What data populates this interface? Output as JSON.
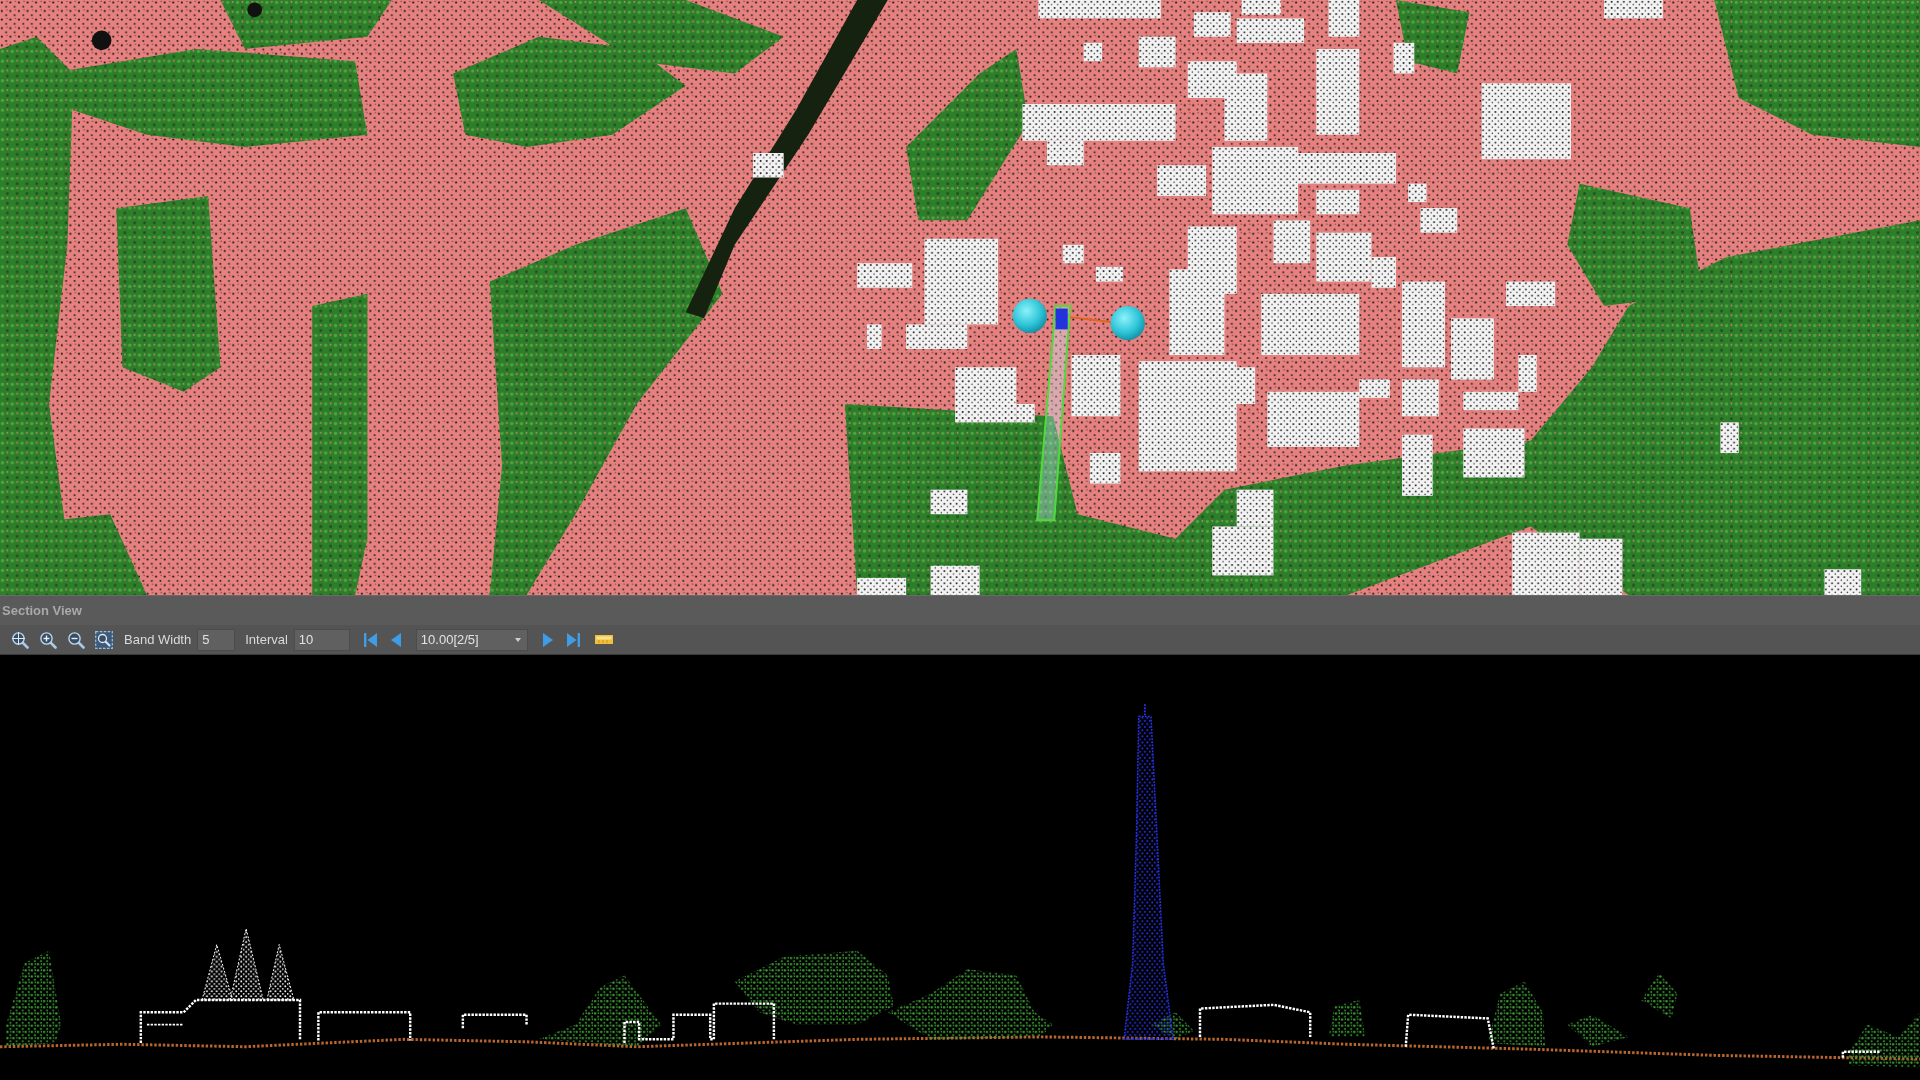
{
  "section_view": {
    "title": "Section View",
    "band_width": {
      "label": "Band Width",
      "value": "5"
    },
    "interval": {
      "label": "Interval",
      "value": "10"
    },
    "section_selector": {
      "value": "10.00[2/5]"
    }
  }
}
